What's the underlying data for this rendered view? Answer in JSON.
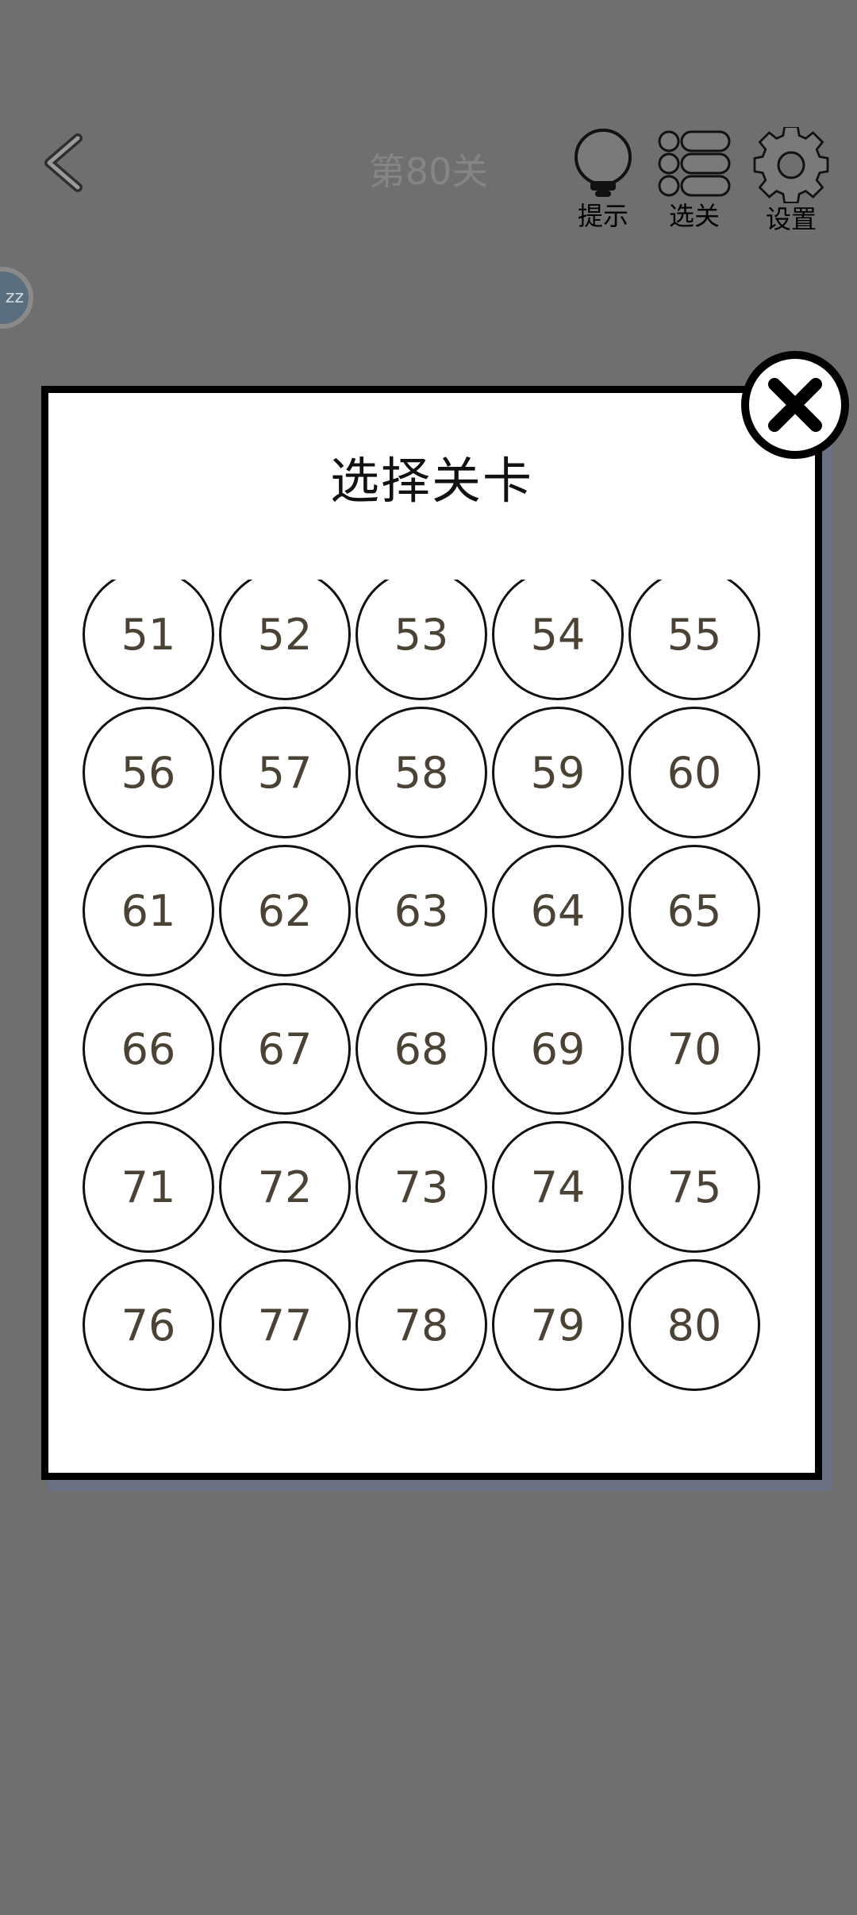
{
  "header": {
    "level_title": "第80关",
    "tools": [
      {
        "label": "提示",
        "icon": "lightbulb-icon"
      },
      {
        "label": "选关",
        "icon": "level-list-icon"
      },
      {
        "label": "设置",
        "icon": "gear-icon"
      }
    ],
    "sleep_badge": "zz"
  },
  "modal": {
    "title": "选择关卡",
    "levels": [
      "51",
      "52",
      "53",
      "54",
      "55",
      "56",
      "57",
      "58",
      "59",
      "60",
      "61",
      "62",
      "63",
      "64",
      "65",
      "66",
      "67",
      "68",
      "69",
      "70",
      "71",
      "72",
      "73",
      "74",
      "75",
      "76",
      "77",
      "78",
      "79",
      "80"
    ]
  },
  "colors": {
    "overlay_bg": "#6f6f6f",
    "modal_bg": "#ffffff",
    "modal_border": "#000000",
    "level_number": "#4a4235",
    "modal_shadow": "#6b7183"
  }
}
